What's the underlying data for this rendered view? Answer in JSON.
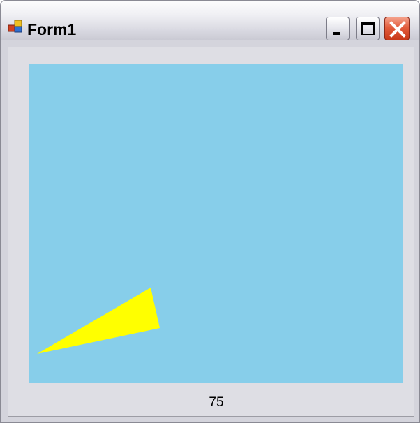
{
  "window": {
    "title": "Form1",
    "icon": "form-app-icon",
    "controls": {
      "minimize_icon": "minimize-icon",
      "maximize_icon": "maximize-icon",
      "close_icon": "close-icon"
    }
  },
  "canvas": {
    "background_color": "#87CEEB",
    "shape_color": "#FFFF00",
    "shape": "triangle"
  },
  "label": {
    "value": "75"
  }
}
